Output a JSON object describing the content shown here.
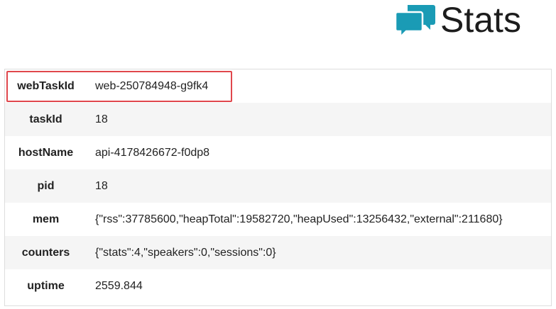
{
  "header": {
    "title": "Stats",
    "icon": "chat-bubbles-icon",
    "icon_color": "#1a9bb5"
  },
  "highlight_color": "#e0474c",
  "rows": [
    {
      "key": "webTaskId",
      "value": "web-250784948-g9fk4"
    },
    {
      "key": "taskId",
      "value": "18"
    },
    {
      "key": "hostName",
      "value": "api-4178426672-f0dp8"
    },
    {
      "key": "pid",
      "value": "18"
    },
    {
      "key": "mem",
      "value": "{\"rss\":37785600,\"heapTotal\":19582720,\"heapUsed\":13256432,\"external\":211680}"
    },
    {
      "key": "counters",
      "value": "{\"stats\":4,\"speakers\":0,\"sessions\":0}"
    },
    {
      "key": "uptime",
      "value": "2559.844"
    }
  ]
}
